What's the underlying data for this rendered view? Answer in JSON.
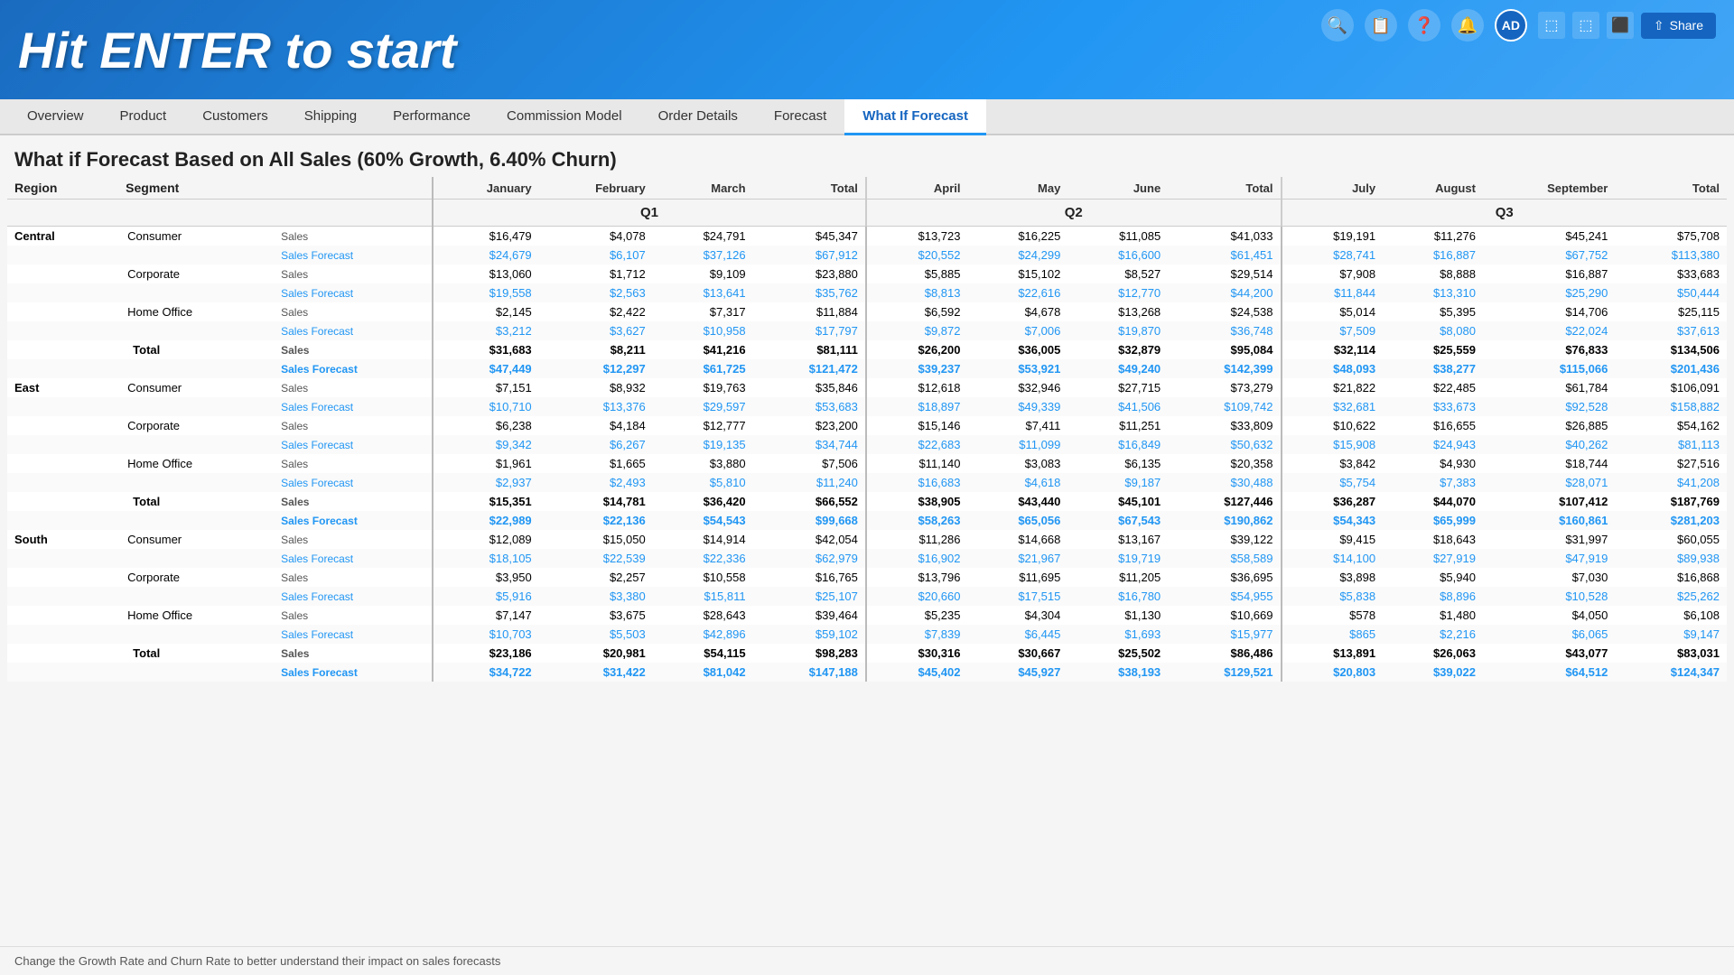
{
  "banner": {
    "title": "Hit ENTER to start"
  },
  "nav": {
    "tabs": [
      "Overview",
      "Product",
      "Customers",
      "Shipping",
      "Performance",
      "Commission Model",
      "Order Details",
      "Forecast",
      "What If Forecast"
    ],
    "active": "What If Forecast"
  },
  "page": {
    "title": "What if Forecast Based on All Sales (60% Growth, 6.40% Churn)"
  },
  "table": {
    "quarters": [
      "Q1",
      "Q2",
      "Q3"
    ],
    "q1_months": [
      "January",
      "February",
      "March",
      "Total"
    ],
    "q2_months": [
      "April",
      "May",
      "June",
      "Total"
    ],
    "q3_months": [
      "July",
      "August",
      "September",
      "Total"
    ],
    "rows": [
      {
        "region": "Central",
        "segment": "Consumer",
        "type": "Sales",
        "q1": [
          "$16,479",
          "$4,078",
          "$24,791",
          "$45,347"
        ],
        "q2": [
          "$13,723",
          "$16,225",
          "$11,085",
          "$41,033"
        ],
        "q3": [
          "$19,191",
          "$11,276",
          "$45,241",
          "$75,708"
        ],
        "forecast": false
      },
      {
        "region": "",
        "segment": "",
        "type": "Sales Forecast",
        "q1": [
          "$24,679",
          "$6,107",
          "$37,126",
          "$67,912"
        ],
        "q2": [
          "$20,552",
          "$24,299",
          "$16,600",
          "$61,451"
        ],
        "q3": [
          "$28,741",
          "$16,887",
          "$67,752",
          "$113,380"
        ],
        "forecast": true
      },
      {
        "region": "",
        "segment": "Corporate",
        "type": "Sales",
        "q1": [
          "$13,060",
          "$1,712",
          "$9,109",
          "$23,880"
        ],
        "q2": [
          "$5,885",
          "$15,102",
          "$8,527",
          "$29,514"
        ],
        "q3": [
          "$7,908",
          "$8,888",
          "$16,887",
          "$33,683"
        ],
        "forecast": false
      },
      {
        "region": "",
        "segment": "",
        "type": "Sales Forecast",
        "q1": [
          "$19,558",
          "$2,563",
          "$13,641",
          "$35,762"
        ],
        "q2": [
          "$8,813",
          "$22,616",
          "$12,770",
          "$44,200"
        ],
        "q3": [
          "$11,844",
          "$13,310",
          "$25,290",
          "$50,444"
        ],
        "forecast": true
      },
      {
        "region": "",
        "segment": "Home Office",
        "type": "Sales",
        "q1": [
          "$2,145",
          "$2,422",
          "$7,317",
          "$11,884"
        ],
        "q2": [
          "$6,592",
          "$4,678",
          "$13,268",
          "$24,538"
        ],
        "q3": [
          "$5,014",
          "$5,395",
          "$14,706",
          "$25,115"
        ],
        "forecast": false
      },
      {
        "region": "",
        "segment": "",
        "type": "Sales Forecast",
        "q1": [
          "$3,212",
          "$3,627",
          "$10,958",
          "$17,797"
        ],
        "q2": [
          "$9,872",
          "$7,006",
          "$19,870",
          "$36,748"
        ],
        "q3": [
          "$7,509",
          "$8,080",
          "$22,024",
          "$37,613"
        ],
        "forecast": true
      },
      {
        "region": "",
        "segment": "Total",
        "type": "Sales",
        "q1": [
          "$31,683",
          "$8,211",
          "$41,216",
          "$81,111"
        ],
        "q2": [
          "$26,200",
          "$36,005",
          "$32,879",
          "$95,084"
        ],
        "q3": [
          "$32,114",
          "$25,559",
          "$76,833",
          "$134,506"
        ],
        "forecast": false,
        "total": true
      },
      {
        "region": "",
        "segment": "",
        "type": "Sales Forecast",
        "q1": [
          "$47,449",
          "$12,297",
          "$61,725",
          "$121,472"
        ],
        "q2": [
          "$39,237",
          "$53,921",
          "$49,240",
          "$142,399"
        ],
        "q3": [
          "$48,093",
          "$38,277",
          "$115,066",
          "$201,436"
        ],
        "forecast": true,
        "total": true
      },
      {
        "region": "East",
        "segment": "Consumer",
        "type": "Sales",
        "q1": [
          "$7,151",
          "$8,932",
          "$19,763",
          "$35,846"
        ],
        "q2": [
          "$12,618",
          "$32,946",
          "$27,715",
          "$73,279"
        ],
        "q3": [
          "$21,822",
          "$22,485",
          "$61,784",
          "$106,091"
        ],
        "forecast": false
      },
      {
        "region": "",
        "segment": "",
        "type": "Sales Forecast",
        "q1": [
          "$10,710",
          "$13,376",
          "$29,597",
          "$53,683"
        ],
        "q2": [
          "$18,897",
          "$49,339",
          "$41,506",
          "$109,742"
        ],
        "q3": [
          "$32,681",
          "$33,673",
          "$92,528",
          "$158,882"
        ],
        "forecast": true
      },
      {
        "region": "",
        "segment": "Corporate",
        "type": "Sales",
        "q1": [
          "$6,238",
          "$4,184",
          "$12,777",
          "$23,200"
        ],
        "q2": [
          "$15,146",
          "$7,411",
          "$11,251",
          "$33,809"
        ],
        "q3": [
          "$10,622",
          "$16,655",
          "$26,885",
          "$54,162"
        ],
        "forecast": false
      },
      {
        "region": "",
        "segment": "",
        "type": "Sales Forecast",
        "q1": [
          "$9,342",
          "$6,267",
          "$19,135",
          "$34,744"
        ],
        "q2": [
          "$22,683",
          "$11,099",
          "$16,849",
          "$50,632"
        ],
        "q3": [
          "$15,908",
          "$24,943",
          "$40,262",
          "$81,113"
        ],
        "forecast": true
      },
      {
        "region": "",
        "segment": "Home Office",
        "type": "Sales",
        "q1": [
          "$1,961",
          "$1,665",
          "$3,880",
          "$7,506"
        ],
        "q2": [
          "$11,140",
          "$3,083",
          "$6,135",
          "$20,358"
        ],
        "q3": [
          "$3,842",
          "$4,930",
          "$18,744",
          "$27,516"
        ],
        "forecast": false
      },
      {
        "region": "",
        "segment": "",
        "type": "Sales Forecast",
        "q1": [
          "$2,937",
          "$2,493",
          "$5,810",
          "$11,240"
        ],
        "q2": [
          "$16,683",
          "$4,618",
          "$9,187",
          "$30,488"
        ],
        "q3": [
          "$5,754",
          "$7,383",
          "$28,071",
          "$41,208"
        ],
        "forecast": true
      },
      {
        "region": "",
        "segment": "Total",
        "type": "Sales",
        "q1": [
          "$15,351",
          "$14,781",
          "$36,420",
          "$66,552"
        ],
        "q2": [
          "$38,905",
          "$43,440",
          "$45,101",
          "$127,446"
        ],
        "q3": [
          "$36,287",
          "$44,070",
          "$107,412",
          "$187,769"
        ],
        "forecast": false,
        "total": true
      },
      {
        "region": "",
        "segment": "",
        "type": "Sales Forecast",
        "q1": [
          "$22,989",
          "$22,136",
          "$54,543",
          "$99,668"
        ],
        "q2": [
          "$58,263",
          "$65,056",
          "$67,543",
          "$190,862"
        ],
        "q3": [
          "$54,343",
          "$65,999",
          "$160,861",
          "$281,203"
        ],
        "forecast": true,
        "total": true
      },
      {
        "region": "South",
        "segment": "Consumer",
        "type": "Sales",
        "q1": [
          "$12,089",
          "$15,050",
          "$14,914",
          "$42,054"
        ],
        "q2": [
          "$11,286",
          "$14,668",
          "$13,167",
          "$39,122"
        ],
        "q3": [
          "$9,415",
          "$18,643",
          "$31,997",
          "$60,055"
        ],
        "forecast": false
      },
      {
        "region": "",
        "segment": "",
        "type": "Sales Forecast",
        "q1": [
          "$18,105",
          "$22,539",
          "$22,336",
          "$62,979"
        ],
        "q2": [
          "$16,902",
          "$21,967",
          "$19,719",
          "$58,589"
        ],
        "q3": [
          "$14,100",
          "$27,919",
          "$47,919",
          "$89,938"
        ],
        "forecast": true
      },
      {
        "region": "",
        "segment": "Corporate",
        "type": "Sales",
        "q1": [
          "$3,950",
          "$2,257",
          "$10,558",
          "$16,765"
        ],
        "q2": [
          "$13,796",
          "$11,695",
          "$11,205",
          "$36,695"
        ],
        "q3": [
          "$3,898",
          "$5,940",
          "$7,030",
          "$16,868"
        ],
        "forecast": false
      },
      {
        "region": "",
        "segment": "",
        "type": "Sales Forecast",
        "q1": [
          "$5,916",
          "$3,380",
          "$15,811",
          "$25,107"
        ],
        "q2": [
          "$20,660",
          "$17,515",
          "$16,780",
          "$54,955"
        ],
        "q3": [
          "$5,838",
          "$8,896",
          "$10,528",
          "$25,262"
        ],
        "forecast": true
      },
      {
        "region": "",
        "segment": "Home Office",
        "type": "Sales",
        "q1": [
          "$7,147",
          "$3,675",
          "$28,643",
          "$39,464"
        ],
        "q2": [
          "$5,235",
          "$4,304",
          "$1,130",
          "$10,669"
        ],
        "q3": [
          "$578",
          "$1,480",
          "$4,050",
          "$6,108"
        ],
        "forecast": false
      },
      {
        "region": "",
        "segment": "",
        "type": "Sales Forecast",
        "q1": [
          "$10,703",
          "$5,503",
          "$42,896",
          "$59,102"
        ],
        "q2": [
          "$7,839",
          "$6,445",
          "$1,693",
          "$15,977"
        ],
        "q3": [
          "$865",
          "$2,216",
          "$6,065",
          "$9,147"
        ],
        "forecast": true
      },
      {
        "region": "",
        "segment": "Total",
        "type": "Sales",
        "q1": [
          "$23,186",
          "$20,981",
          "$54,115",
          "$98,283"
        ],
        "q2": [
          "$30,316",
          "$30,667",
          "$25,502",
          "$86,486"
        ],
        "q3": [
          "$13,891",
          "$26,063",
          "$43,077",
          "$83,031"
        ],
        "forecast": false,
        "total": true
      },
      {
        "region": "",
        "segment": "",
        "type": "Sales Forecast",
        "q1": [
          "$34,722",
          "$31,422",
          "$81,042",
          "$147,188"
        ],
        "q2": [
          "$45,402",
          "$45,927",
          "$38,193",
          "$129,521"
        ],
        "q3": [
          "$20,803",
          "$39,022",
          "$64,512",
          "$124,347"
        ],
        "forecast": true,
        "total": true
      }
    ]
  },
  "footer": {
    "note": "Change the Growth Rate and Churn Rate to better understand their impact on sales forecasts"
  },
  "toolbar": {
    "icons": [
      "🔍",
      "📋",
      "❓",
      "🔔"
    ],
    "avatar": "AD",
    "share": "Share",
    "toolbar_icons": [
      "⬚",
      "⬚⬚",
      "⬛"
    ]
  }
}
